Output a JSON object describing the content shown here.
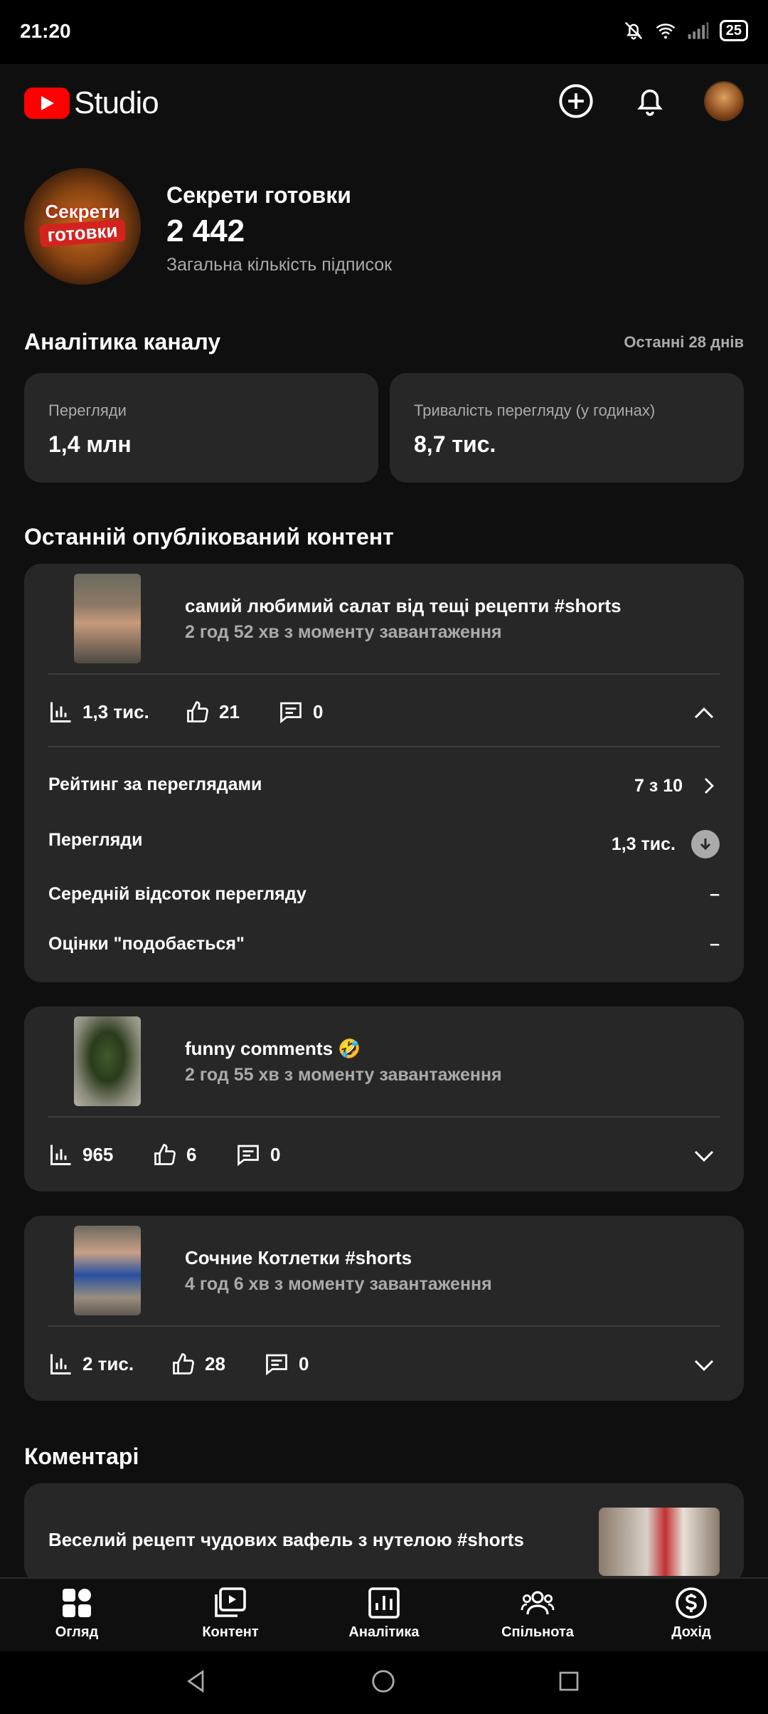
{
  "status": {
    "time": "21:20",
    "battery": "25"
  },
  "app": {
    "logo_text": "Studio"
  },
  "channel": {
    "avatar_line1": "Секрети",
    "avatar_line2": "готовки",
    "name": "Секрети готовки",
    "subscribers": "2 442",
    "subscribers_label": "Загальна кількість підписок"
  },
  "analytics": {
    "title": "Аналітика каналу",
    "period": "Останні 28 днів",
    "metrics": [
      {
        "label": "Перегляди",
        "value": "1,4 млн"
      },
      {
        "label": "Тривалість перегляду (у годинах)",
        "value": "8,7 тис."
      }
    ]
  },
  "recent": {
    "title": "Останній опублікований контент",
    "items": [
      {
        "title": "самий любимий салат від тещі рецепти #shorts",
        "age": "2 год 52 хв з моменту завантаження",
        "views": "1,3 тис.",
        "likes": "21",
        "comments": "0",
        "details": [
          {
            "label": "Рейтинг за переглядами",
            "value": "7 з 10"
          },
          {
            "label": "Перегляди",
            "value": "1,3 тис."
          },
          {
            "label": "Середній відсоток перегляду",
            "value": "–"
          },
          {
            "label": "Оцінки \"подобається\"",
            "value": "–"
          }
        ]
      },
      {
        "title": "funny comments 🤣",
        "age": "2 год 55 хв з моменту завантаження",
        "views": "965",
        "likes": "6",
        "comments": "0"
      },
      {
        "title": "Сочние Котлетки #shorts",
        "age": "4 год 6 хв з моменту завантаження",
        "views": "2 тис.",
        "likes": "28",
        "comments": "0"
      }
    ]
  },
  "comments": {
    "title": "Коментарі",
    "first_video_title": "Веселий рецепт чудових вафель з нутелою #shorts"
  },
  "nav": {
    "items": [
      "Огляд",
      "Контент",
      "Аналітика",
      "Спільнота",
      "Дохід"
    ]
  }
}
